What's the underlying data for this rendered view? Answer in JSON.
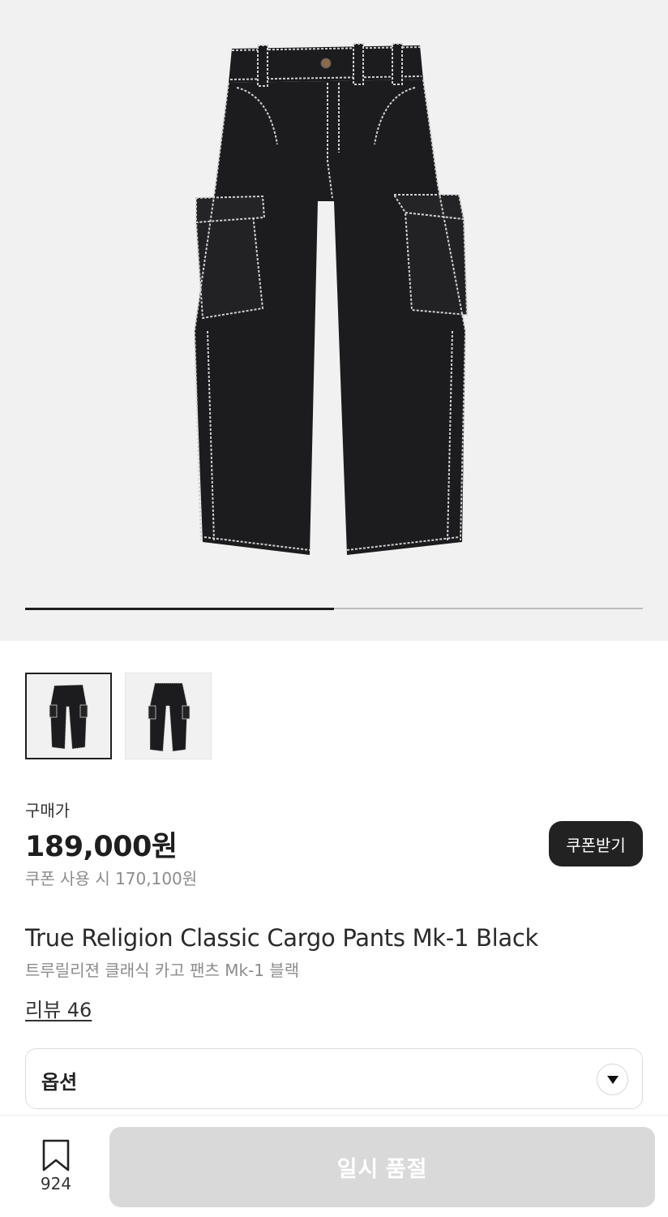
{
  "hero": {
    "image_icon": "cargo-pants-product-photo",
    "slide_progress": 0.5
  },
  "thumbnails": [
    {
      "icon": "cargo-pants-front-thumbnail",
      "selected": true
    },
    {
      "icon": "cargo-pants-angle-thumbnail",
      "selected": false
    }
  ],
  "price": {
    "label": "구매가",
    "value": "189,000원",
    "coupon_text": "쿠폰 사용 시 170,100원",
    "coupon_button": "쿠폰받기"
  },
  "product": {
    "title_en": "True Religion Classic Cargo Pants Mk-1 Black",
    "title_ko": "트루릴리젼 클래식 카고 팬츠 Mk-1 블랙",
    "reviews": "리뷰 46"
  },
  "option": {
    "label": "옵션",
    "icon": "chevron-down-icon"
  },
  "bottom_bar": {
    "bookmark_icon": "bookmark-icon",
    "bookmark_count": "924",
    "action_label": "일시 품절"
  },
  "colors": {
    "hero_bg": "#f1f1f1",
    "dark": "#222222",
    "muted": "#8c8c8c",
    "disabled": "#d9d9d9"
  }
}
